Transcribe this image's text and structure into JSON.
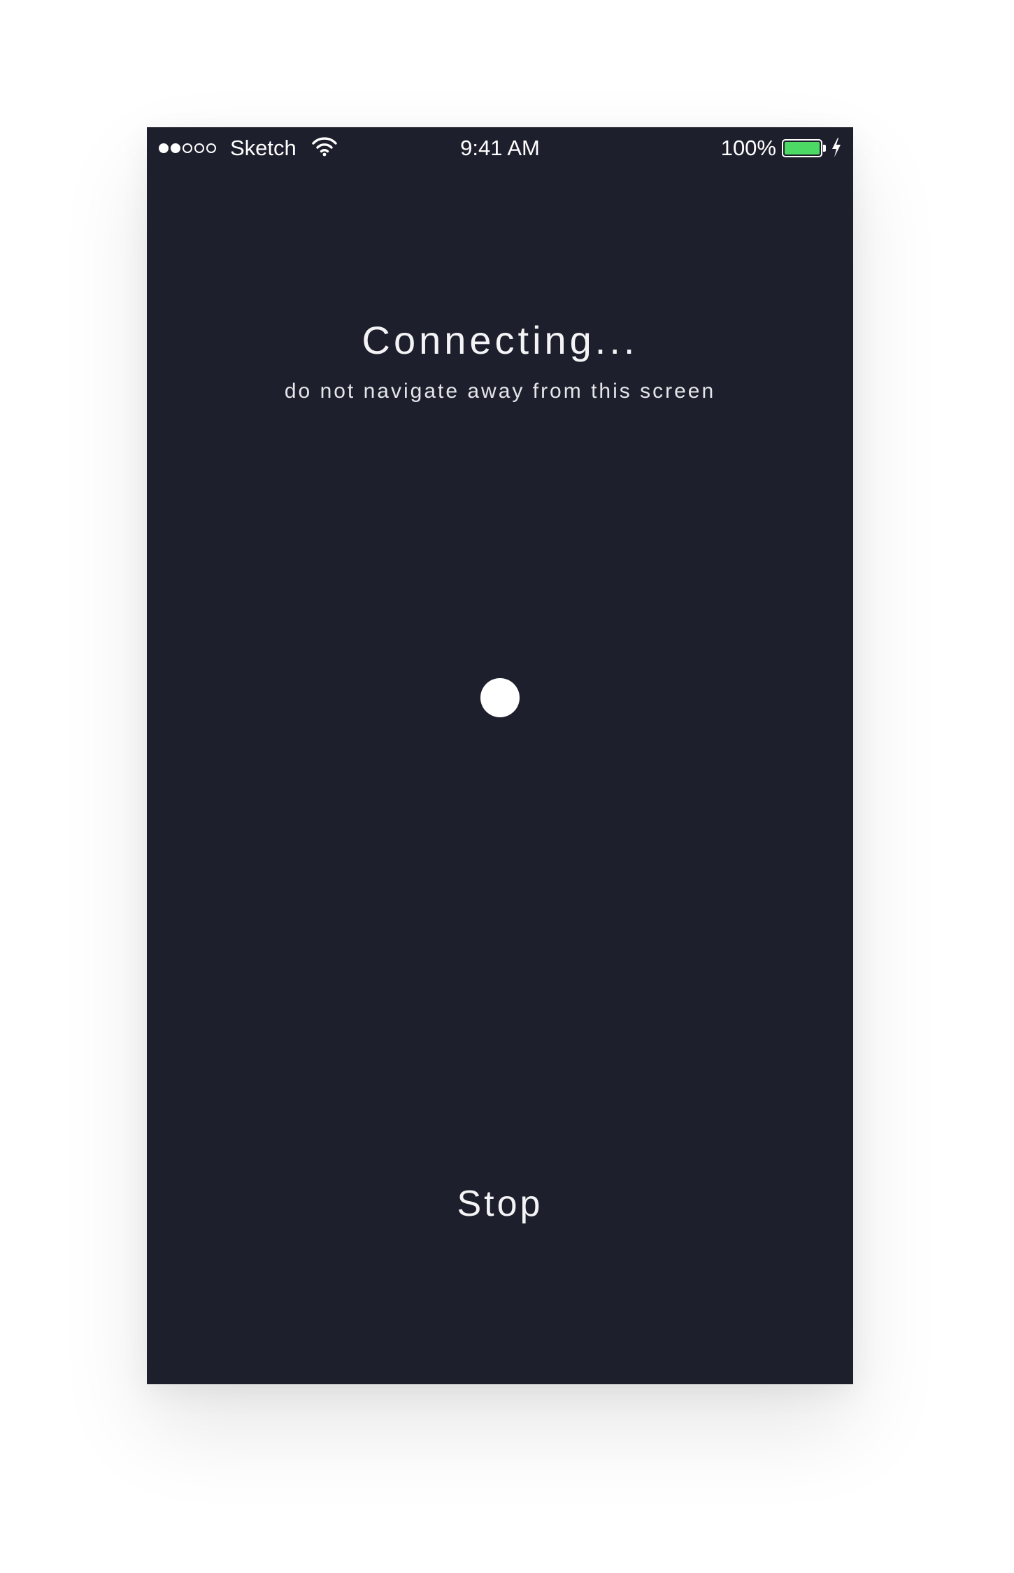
{
  "status_bar": {
    "signal_full": 2,
    "signal_total": 5,
    "carrier": "Sketch",
    "time": "9:41 AM",
    "battery_percent_label": "100%",
    "battery_level": 1.0,
    "battery_color": "#4cd964",
    "charging": true
  },
  "screen": {
    "background": "#1d1f2c",
    "title": "Connecting...",
    "subtitle": "do not navigate away from this screen",
    "stop_label": "Stop"
  }
}
